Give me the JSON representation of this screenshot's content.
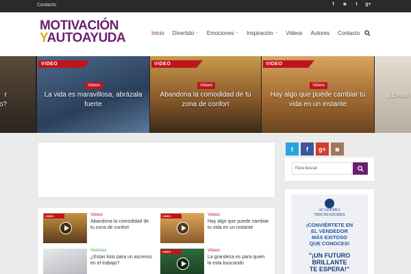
{
  "topbar": {
    "contact": "Contacto",
    "social_icons": [
      "facebook-icon",
      "instagram-icon",
      "twitter-icon",
      "googleplus-icon"
    ],
    "social_glyphs": [
      "f",
      "◙",
      "t",
      "g+"
    ]
  },
  "logo": {
    "line1": "MOTIVACIÓN",
    "line2_y": "Y",
    "line2_rest": "AUTOAYUDA"
  },
  "nav": {
    "items": [
      {
        "label": "Inicio",
        "active": true,
        "dropdown": false
      },
      {
        "label": "Divertido",
        "dropdown": true
      },
      {
        "label": "Emociones",
        "dropdown": true
      },
      {
        "label": "Inspiración",
        "dropdown": true
      },
      {
        "label": "Videos",
        "dropdown": false
      },
      {
        "label": "Autores",
        "dropdown": false
      },
      {
        "label": "Contacto",
        "dropdown": false
      }
    ],
    "search_icon": "search-icon"
  },
  "slider": {
    "badge": "VIDEO",
    "slides": [
      {
        "title": "r\no?",
        "category": ""
      },
      {
        "title": "La vida es maravillosa, abrázala fuerte",
        "category": "Videos"
      },
      {
        "title": "Abandona la comodidad de tu zona de confort",
        "category": "Videos"
      },
      {
        "title": "Hay algo que puede cambiar tu vida en un instante",
        "category": "Videos"
      },
      {
        "title": "¿Estas l",
        "category": ""
      }
    ]
  },
  "cards": [
    {
      "category": "Videos",
      "title": "Abandona la comodidad de tu zona de confort"
    },
    {
      "category": "Videos",
      "title": "Hay algo que puede cambiar tu vida en un instante"
    },
    {
      "category": "Historias",
      "title": "¿Estas listo para un ascenso en el trabajo?"
    },
    {
      "category": "Videos",
      "title": "La grandeza es para quien la esta buscando"
    }
  ],
  "sidebar": {
    "social": [
      "twitter-icon",
      "facebook-icon",
      "googleplus-icon",
      "instagram-icon"
    ],
    "search_placeholder": "Para buscar",
    "banner": {
      "academy": "ACADEMIA\nTRIUNFADORES",
      "line1": "¡CONVIÉRTETE EN\nEL VENDEDOR\nMÁS EXITOSO\nQUE CONOCES!",
      "line2": "\"¡UN FUTURO\nBRILLANTE\nTE ESPERA!\""
    }
  },
  "colors": {
    "brand": "#6b1e6e",
    "accent": "#e0a91c",
    "red": "#c0141d"
  }
}
